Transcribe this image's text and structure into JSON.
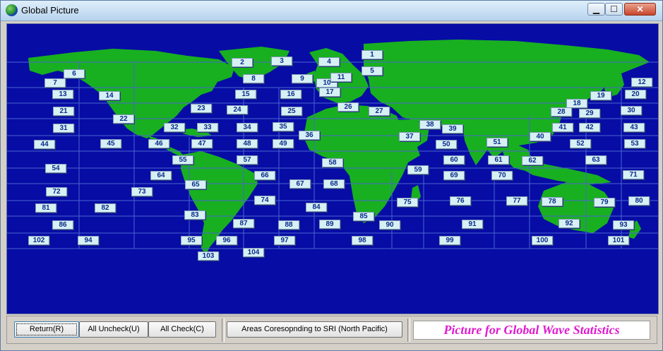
{
  "window": {
    "title": "Global Picture",
    "controls": {
      "minimize": "▁",
      "maximize": "☐",
      "close": "✕"
    }
  },
  "map": {
    "ocean_color": "#070ca5",
    "land_color": "#18b020",
    "grid_color": "#4a64d0",
    "zones": [
      "1",
      "2",
      "3",
      "4",
      "5",
      "6",
      "7",
      "8",
      "9",
      "10",
      "11",
      "12",
      "13",
      "14",
      "15",
      "16",
      "17",
      "18",
      "19",
      "20",
      "21",
      "22",
      "23",
      "24",
      "25",
      "26",
      "27",
      "28",
      "29",
      "30",
      "31",
      "32",
      "33",
      "34",
      "35",
      "36",
      "37",
      "38",
      "39",
      "40",
      "41",
      "42",
      "43",
      "44",
      "45",
      "46",
      "47",
      "48",
      "49",
      "50",
      "51",
      "52",
      "53",
      "54",
      "55",
      "57",
      "58",
      "59",
      "60",
      "61",
      "62",
      "63",
      "64",
      "65",
      "66",
      "67",
      "68",
      "69",
      "70",
      "71",
      "72",
      "73",
      "74",
      "75",
      "76",
      "77",
      "78",
      "79",
      "80",
      "81",
      "82",
      "83",
      "84",
      "85",
      "86",
      "87",
      "88",
      "89",
      "90",
      "91",
      "92",
      "93",
      "94",
      "95",
      "96",
      "97",
      "98",
      "99",
      "100",
      "101",
      "102",
      "103",
      "104"
    ]
  },
  "buttons": {
    "return": "Return(R)",
    "uncheck_all": "All Uncheck(U)",
    "check_all": "All Check(C)",
    "sri": "Areas Coresopnding to SRI (North Pacific)"
  },
  "caption": "Picture for Global Wave Statistics",
  "caption_color": "#e01ad0"
}
